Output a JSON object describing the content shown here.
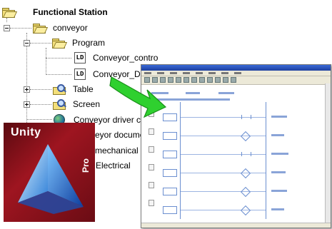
{
  "tree": {
    "root": {
      "label": "Functional  Station",
      "icon": "folder-open-icon"
    },
    "conveyor": {
      "label": "conveyor",
      "icon": "folder-open-icon"
    },
    "program": {
      "label": "Program",
      "icon": "folder-open-icon"
    },
    "program_items": [
      {
        "icon_text": "LD",
        "label": "Conveyor_contro"
      },
      {
        "icon_text": "LD",
        "label": "Conveyor_D"
      }
    ],
    "table": {
      "label": "Table",
      "icon": "magnifier-folder-icon"
    },
    "screen": {
      "label": "Screen",
      "icon": "magnifier-folder-icon"
    },
    "driver": {
      "label": "Conveyor driver c",
      "icon": "globe-icon"
    },
    "docs": {
      "label": "veyor docume"
    },
    "mechanical": {
      "label": "mechanical"
    },
    "electrical": {
      "label": "Electrical"
    }
  },
  "logo": {
    "name": "Unity",
    "suffix": "Pro"
  },
  "colors": {
    "arrow": "#2fd02f",
    "logo_background": "#9e1520",
    "window_title": "#1d3f9e"
  }
}
